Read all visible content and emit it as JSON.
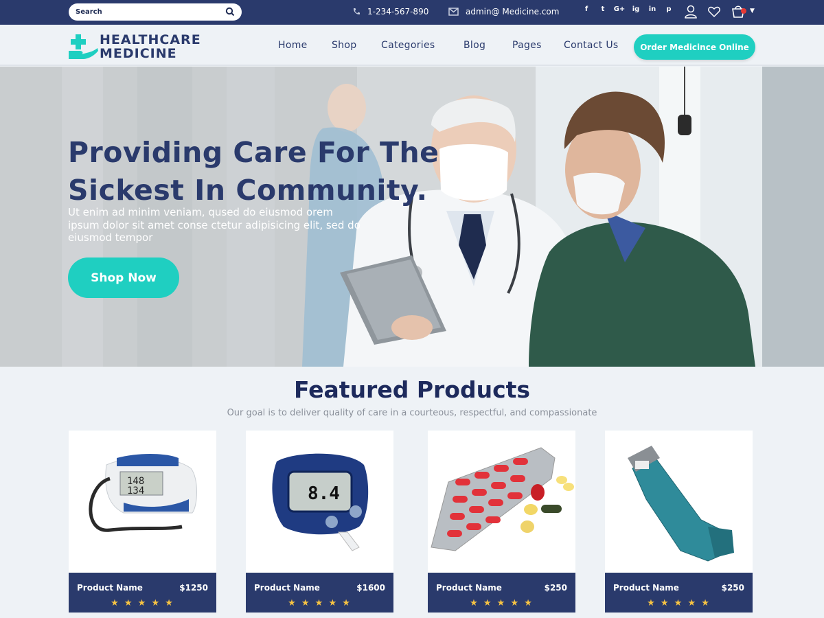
{
  "topbar": {
    "search_placeholder": "Search",
    "phone": "1-234-567-890",
    "email": "admin@ Medicine.com",
    "social": [
      "f",
      "t",
      "G+",
      "ig",
      "in",
      "p"
    ],
    "icons": [
      "user-icon",
      "heart-icon",
      "cart-icon"
    ]
  },
  "brand": {
    "line1": "HEALTHCARE",
    "line2": "MEDICINE"
  },
  "nav": {
    "items": [
      "Home",
      "Shop",
      "Categories",
      "Blog",
      "Pages",
      "Contact Us"
    ],
    "cta": "Order Medicince Online"
  },
  "hero": {
    "title": "Providing Care For The\nSickest In Community.",
    "text": "Ut enim ad minim veniam, qused do eiusmod orem ipsum dolor sit amet conse ctetur adipisicing elit, sed do eiusmod tempor",
    "button": "Shop Now"
  },
  "featured": {
    "title": "Featured Products",
    "subtitle": "Our goal is to deliver quality of care in a courteous, respectful, and compassionate",
    "products": [
      {
        "name": "Product Name",
        "price": "$1250",
        "rating": 5,
        "image": "blood-pressure-monitor"
      },
      {
        "name": "Product Name",
        "price": "$1600",
        "rating": 5,
        "image": "glucose-meter"
      },
      {
        "name": "Product Name",
        "price": "$250",
        "rating": 5,
        "image": "capsule-blister-pack"
      },
      {
        "name": "Product Name",
        "price": "$250",
        "rating": 5,
        "image": "inhaler"
      }
    ],
    "star_glyphs": "★ ★ ★ ★ ★"
  },
  "colors": {
    "navy": "#2a3a6c",
    "teal": "#1fcfc1",
    "star": "#f6c343"
  }
}
